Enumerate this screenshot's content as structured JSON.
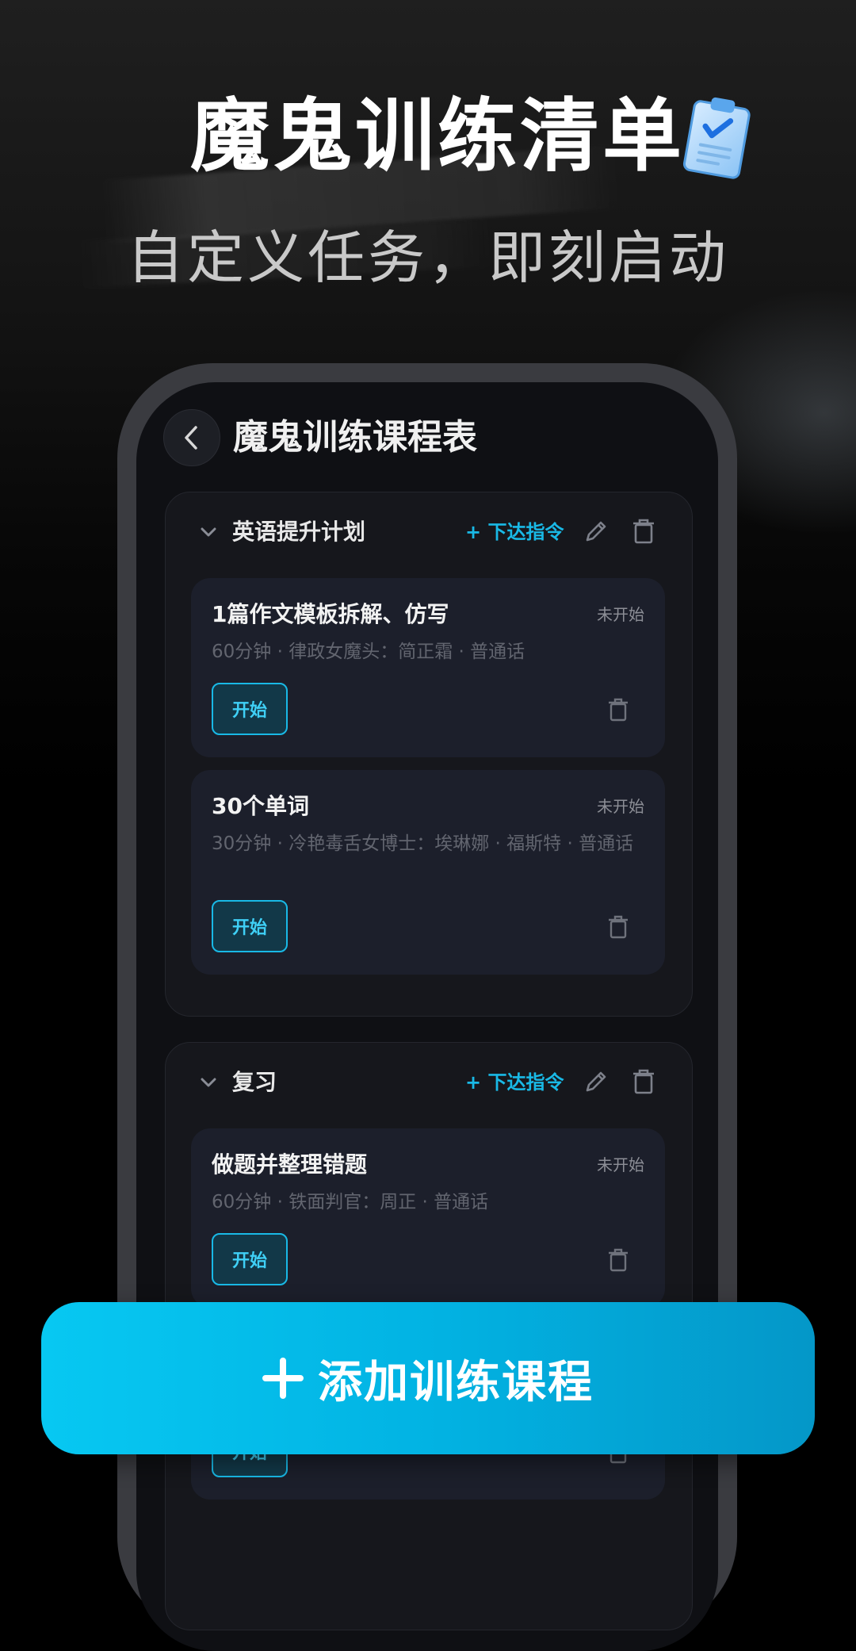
{
  "hero": {
    "title": "魔鬼训练清单",
    "subtitle": "自定义任务，即刻启动"
  },
  "screen": {
    "title": "魔鬼训练课程表"
  },
  "groups": [
    {
      "name": "英语提升计划",
      "command_label": "+ 下达指令",
      "tasks": [
        {
          "title": "1篇作文模板拆解、仿写",
          "status": "未开始",
          "meta": "60分钟 · 律政女魔头：简正霜 · 普通话",
          "start_label": "开始"
        },
        {
          "title": "30个单词",
          "status": "未开始",
          "meta": "30分钟 · 冷艳毒舌女博士：埃琳娜 · 福斯特 · 普通话",
          "start_label": "开始"
        }
      ]
    },
    {
      "name": "复习",
      "command_label": "+ 下达指令",
      "tasks": [
        {
          "title": "做题并整理错题",
          "status": "未开始",
          "meta": "60分钟 · 铁面判官：周正 · 普通话",
          "start_label": "开始"
        },
        {
          "start_label": "开始"
        }
      ]
    }
  ],
  "add_button": {
    "label": "添加训练课程"
  },
  "colors": {
    "accent": "#19b9e6",
    "button_gradient_start": "#07c8f2",
    "button_gradient_end": "#0497c8"
  }
}
